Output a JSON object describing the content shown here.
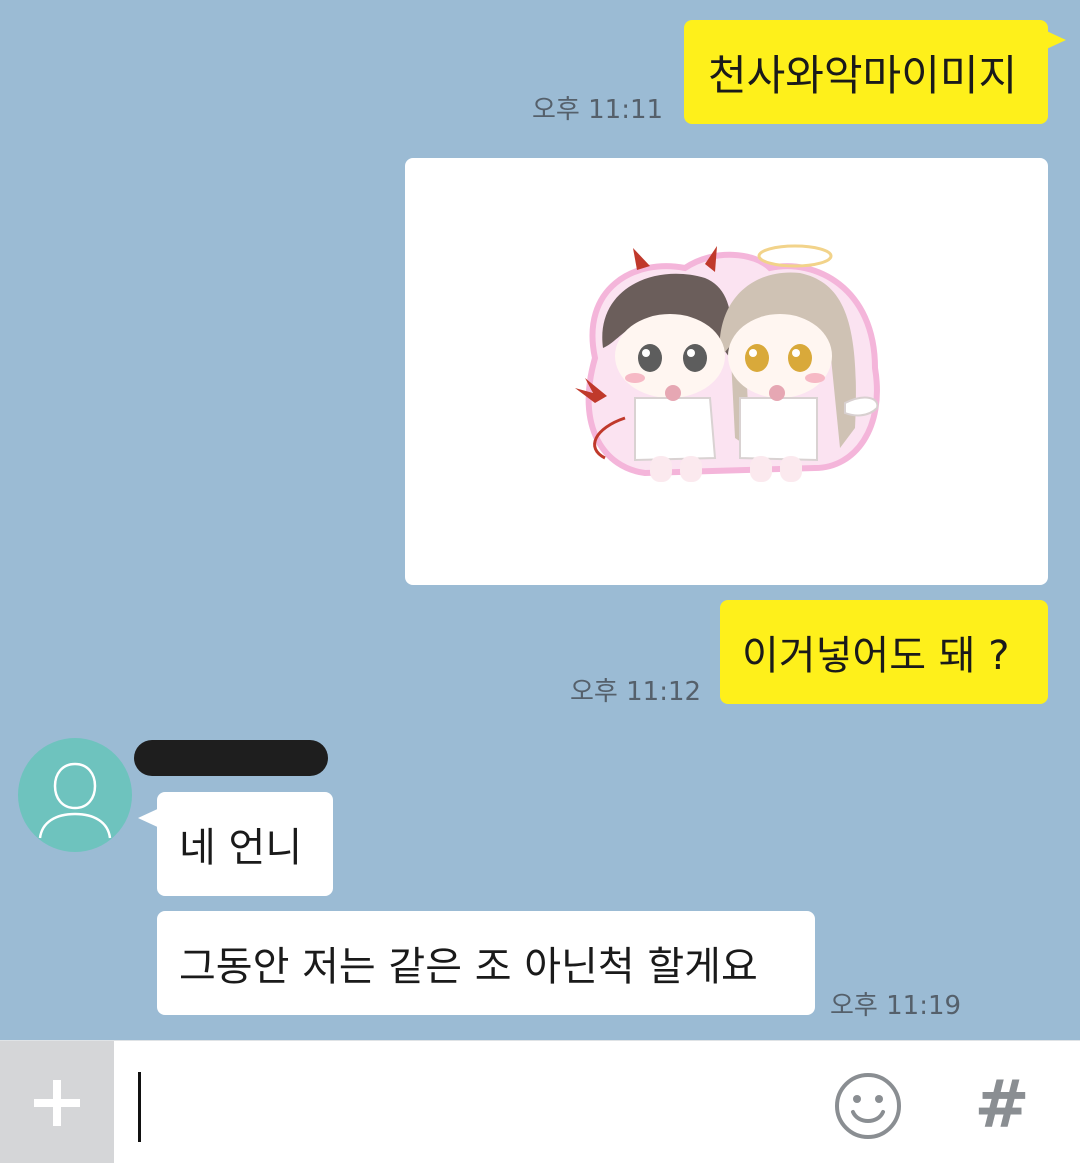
{
  "messages": [
    {
      "id": 1,
      "direction": "outgoing",
      "type": "text",
      "text": "천사와악마이미지",
      "time": "오후 11:11"
    },
    {
      "id": 2,
      "direction": "outgoing",
      "type": "image",
      "image": "chibi-angel-and-devil-sticker"
    },
    {
      "id": 3,
      "direction": "outgoing",
      "type": "text",
      "text": "이거넣어도 돼 ?",
      "time": "오후 11:12"
    },
    {
      "id": 4,
      "direction": "incoming",
      "type": "text",
      "text": "네 언니"
    },
    {
      "id": 5,
      "direction": "incoming",
      "type": "text",
      "text": "그동안 저는 같은 조 아닌척 할게요",
      "time": "오후 11:19"
    }
  ],
  "input_bar": {
    "placeholder": "",
    "plus_icon": "plus-icon",
    "emoji_icon": "smiley-icon",
    "hash_label": "#"
  },
  "colors": {
    "chat_background": "#9bbbd4",
    "outgoing_bubble": "#fef01b",
    "incoming_bubble": "#ffffff",
    "avatar": "#6ec3be"
  }
}
